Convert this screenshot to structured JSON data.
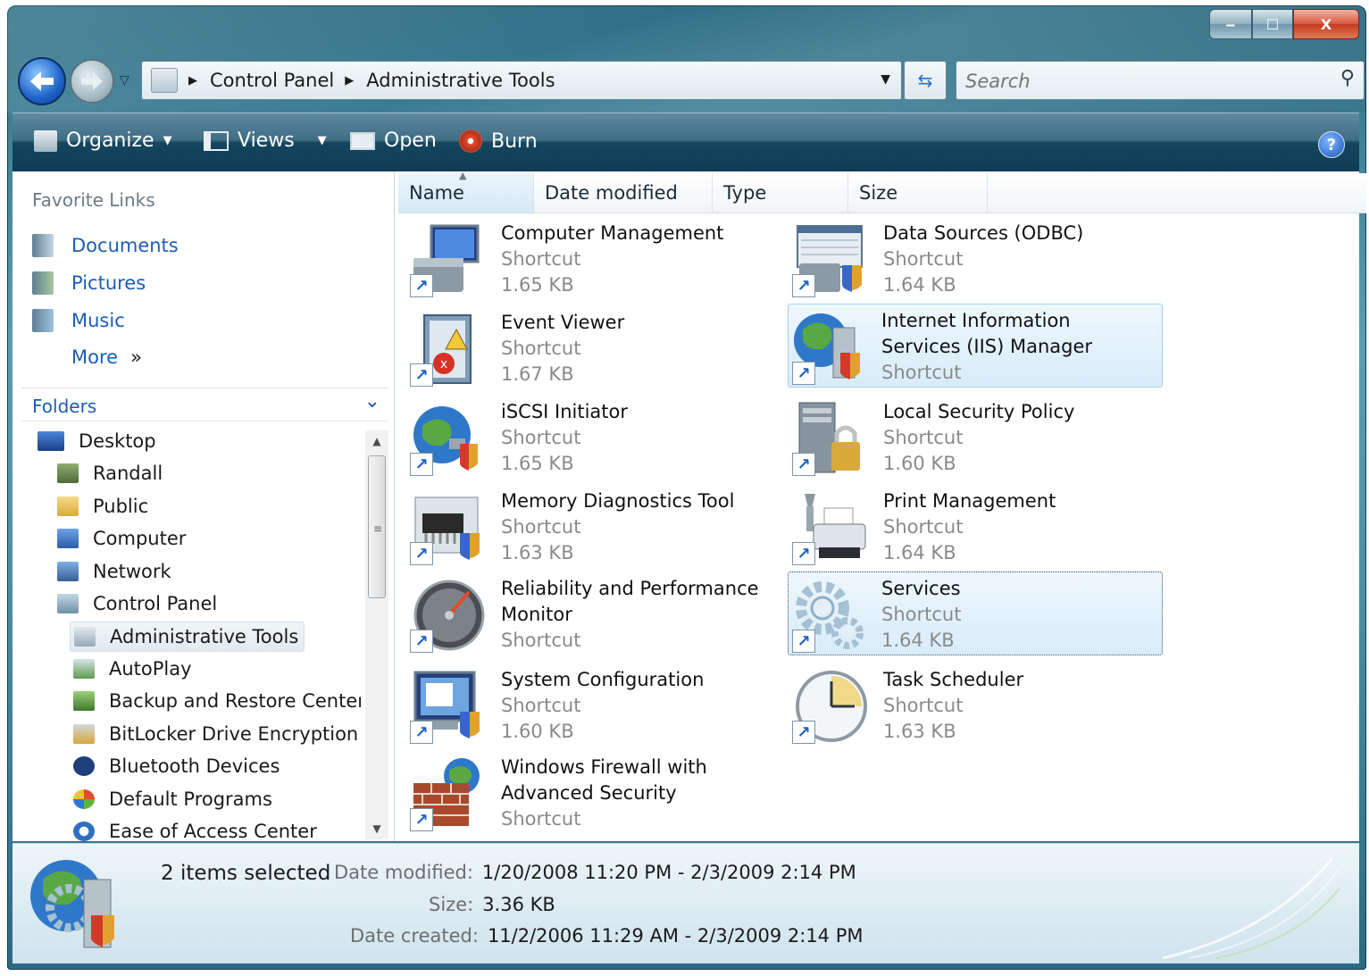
{
  "window": {
    "caption_buttons": {
      "minimize": "‒",
      "maximize": "☐",
      "close": "X"
    }
  },
  "address": {
    "crumbs": [
      "Control Panel",
      "Administrative Tools"
    ],
    "separator": "▶"
  },
  "search": {
    "placeholder": "Search"
  },
  "toolbar": {
    "organize": "Organize",
    "views": "Views",
    "open": "Open",
    "burn": "Burn",
    "help": "?"
  },
  "left_pane": {
    "favorite_links_title": "Favorite Links",
    "favorites": [
      "Documents",
      "Pictures",
      "Music",
      "More"
    ],
    "more_chevron": "»",
    "folders_title": "Folders",
    "folders_chevron": "⌄",
    "tree": [
      "Desktop",
      "Randall",
      "Public",
      "Computer",
      "Network",
      "Control Panel",
      "Administrative Tools",
      "AutoPlay",
      "Backup and Restore Center",
      "BitLocker Drive Encryption",
      "Bluetooth Devices",
      "Default Programs",
      "Ease of Access Center"
    ],
    "selected_tree_item": "Administrative Tools"
  },
  "columns": [
    "Name",
    "Date modified",
    "Type",
    "Size"
  ],
  "items": [
    {
      "name": "Computer Management",
      "line2": "Shortcut",
      "line3": "1.65 KB",
      "icon": "computer-management-icon"
    },
    {
      "name": "Data Sources (ODBC)",
      "line2": "Shortcut",
      "line3": "1.64 KB",
      "icon": "odbc-icon"
    },
    {
      "name": "Event Viewer",
      "line2": "Shortcut",
      "line3": "1.67 KB",
      "icon": "event-viewer-icon"
    },
    {
      "name": "Internet Information Services (IIS) Manager",
      "line2": "Shortcut",
      "line3": "",
      "icon": "iis-icon"
    },
    {
      "name": "iSCSI Initiator",
      "line2": "Shortcut",
      "line3": "1.65 KB",
      "icon": "iscsi-icon"
    },
    {
      "name": "Local Security Policy",
      "line2": "Shortcut",
      "line3": "1.60 KB",
      "icon": "security-policy-icon"
    },
    {
      "name": "Memory Diagnostics Tool",
      "line2": "Shortcut",
      "line3": "1.63 KB",
      "icon": "memory-icon"
    },
    {
      "name": "Print Management",
      "line2": "Shortcut",
      "line3": "1.64 KB",
      "icon": "printer-icon"
    },
    {
      "name": "Reliability and Performance Monitor",
      "line2": "Shortcut",
      "line3": "",
      "icon": "gauge-icon"
    },
    {
      "name": "Services",
      "line2": "Shortcut",
      "line3": "1.64 KB",
      "icon": "gears-icon"
    },
    {
      "name": "System Configuration",
      "line2": "Shortcut",
      "line3": "1.60 KB",
      "icon": "system-config-icon"
    },
    {
      "name": "Task Scheduler",
      "line2": "Shortcut",
      "line3": "1.63 KB",
      "icon": "clock-icon"
    },
    {
      "name": "Windows Firewall with Advanced Security",
      "line2": "Shortcut",
      "line3": "",
      "icon": "firewall-icon"
    }
  ],
  "details": {
    "selection": "2 items selected",
    "date_modified_label": "Date modified:",
    "date_modified_value": "1/20/2008 11:20 PM - 2/3/2009 2:14 PM",
    "size_label": "Size:",
    "size_value": "3.36 KB",
    "date_created_label": "Date created:",
    "date_created_value": "11/2/2006 11:29 AM - 2/3/2009 2:14 PM"
  },
  "colors": {
    "link_blue": "#1b5db6",
    "selection_bg": "#d8ecf9",
    "toolbar_dark": "#0f3c54"
  }
}
